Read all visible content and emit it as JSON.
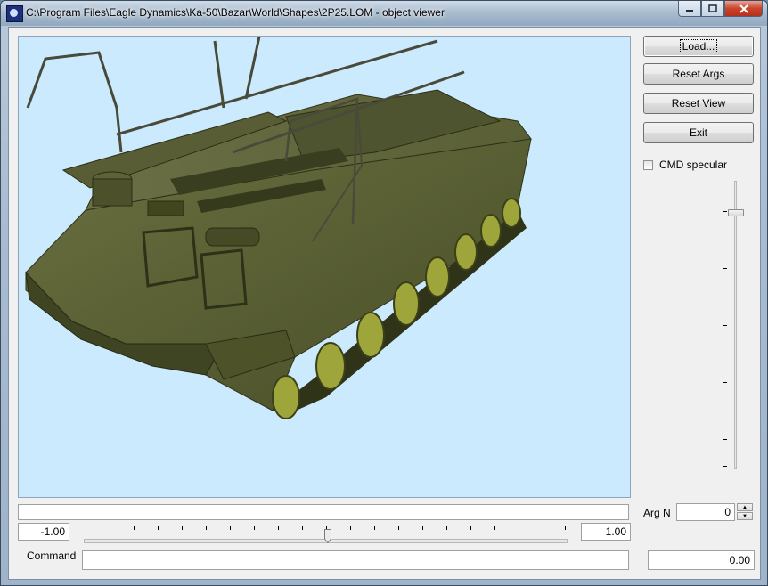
{
  "window": {
    "title": "C:\\Program Files\\Eagle Dynamics\\Ka-50\\Bazar\\World\\Shapes\\2P25.LOM - object viewer",
    "minimize_icon": "minimize-icon",
    "maximize_icon": "maximize-icon",
    "close_icon": "close-icon"
  },
  "viewport": {
    "background": "#cbeafd",
    "model_color": "#5c6333"
  },
  "buttons": {
    "load": "Load...",
    "reset_args": "Reset Args",
    "reset_view": "Reset View",
    "exit": "Exit"
  },
  "options": {
    "cmd_specular_label": "CMD specular",
    "cmd_specular_checked": false
  },
  "slider": {
    "min_value": "-1.00",
    "max_value": "1.00"
  },
  "arg": {
    "label": "Arg N",
    "value": "0"
  },
  "command": {
    "label": "Command",
    "value": ""
  },
  "output_value": "0.00"
}
